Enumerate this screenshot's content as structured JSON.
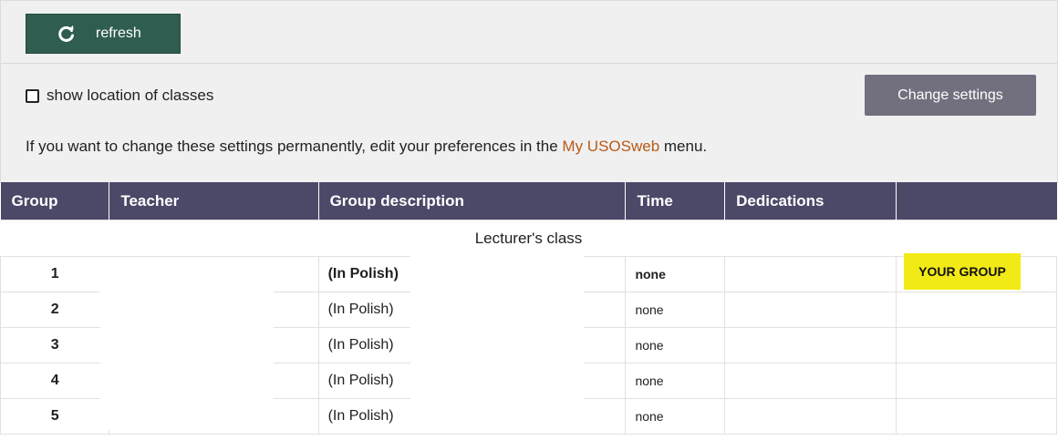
{
  "toolbar": {
    "refresh_label": "refresh",
    "refresh_icon": "refresh-icon"
  },
  "settings": {
    "show_location_label": "show location of classes",
    "show_location_checked": false,
    "change_settings_label": "Change settings",
    "preferences_text_before": "If you want to change these settings permanently, edit your preferences in the ",
    "preferences_link": "My USOSweb",
    "preferences_text_after": " menu."
  },
  "table": {
    "headers": [
      "Group",
      "Teacher",
      "Group description",
      "Time",
      "Dedications",
      ""
    ],
    "section_label": "Lecturer's class",
    "rows": [
      {
        "group": "1",
        "description": "(In Polish)",
        "time": "none",
        "badge": "YOUR GROUP"
      },
      {
        "group": "2",
        "description": "(In Polish)",
        "time": "none",
        "badge": ""
      },
      {
        "group": "3",
        "description": "(In Polish)",
        "time": "none",
        "badge": ""
      },
      {
        "group": "4",
        "description": "(In Polish)",
        "time": "none",
        "badge": ""
      },
      {
        "group": "5",
        "description": "(In Polish)",
        "time": "none",
        "badge": ""
      }
    ]
  },
  "colors": {
    "header_bg": "#4b4868",
    "refresh_button_bg": "#2f5d50",
    "change_settings_bg": "#72707f",
    "link": "#b85a16",
    "badge_bg": "#f2ea16"
  }
}
